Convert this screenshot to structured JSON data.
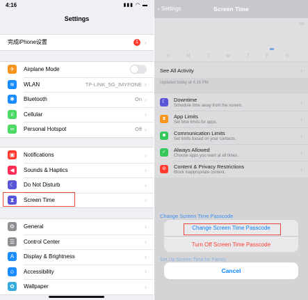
{
  "left": {
    "status_time": "4:16",
    "nav_title": "Settings",
    "setup_row": {
      "label": "完成iPhone设置",
      "badge": "1"
    },
    "group_connectivity": [
      {
        "label": "Airplane Mode",
        "value": "",
        "icon": "airplane-icon",
        "color": "#f7941d",
        "glyph": "✈"
      },
      {
        "label": "WLAN",
        "value": "TP-LINK_5G_IMYFONE",
        "icon": "wifi-icon",
        "color": "#1a8cff",
        "glyph": "≋"
      },
      {
        "label": "Bluetooth",
        "value": "On",
        "icon": "bluetooth-icon",
        "color": "#1a8cff",
        "glyph": "✱"
      },
      {
        "label": "Cellular",
        "value": "",
        "icon": "cellular-icon",
        "color": "#4cd964",
        "glyph": "ıl"
      },
      {
        "label": "Personal Hotspot",
        "value": "Off",
        "icon": "hotspot-icon",
        "color": "#4cd964",
        "glyph": "∞"
      }
    ],
    "group_notifications": [
      {
        "label": "Notifications",
        "value": "",
        "icon": "notifications-icon",
        "color": "#ff3b30",
        "glyph": "▣"
      },
      {
        "label": "Sounds & Haptics",
        "value": "",
        "icon": "sounds-icon",
        "color": "#ff2d55",
        "glyph": "◀"
      },
      {
        "label": "Do Not Disturb",
        "value": "",
        "icon": "moon-icon",
        "color": "#5856d6",
        "glyph": "☾"
      },
      {
        "label": "Screen Time",
        "value": "",
        "icon": "hourglass-icon",
        "color": "#5856d6",
        "glyph": "⧗"
      }
    ],
    "group_general": [
      {
        "label": "General",
        "value": "",
        "icon": "gear-icon",
        "color": "#8e8e93",
        "glyph": "⚙"
      },
      {
        "label": "Control Center",
        "value": "",
        "icon": "control-center-icon",
        "color": "#8e8e93",
        "glyph": "☰"
      },
      {
        "label": "Display & Brightness",
        "value": "",
        "icon": "display-icon",
        "color": "#1a8cff",
        "glyph": "A"
      },
      {
        "label": "Accessibility",
        "value": "",
        "icon": "accessibility-icon",
        "color": "#1a8cff",
        "glyph": "☺"
      },
      {
        "label": "Wallpaper",
        "value": "",
        "icon": "wallpaper-icon",
        "color": "#35aadc",
        "glyph": "✿"
      }
    ]
  },
  "right": {
    "back_label": "Settings",
    "nav_title": "Screen Time",
    "chart_days": [
      "S",
      "M",
      "T",
      "W",
      "T",
      "F",
      "S"
    ],
    "chart_tick": "0h",
    "see_all": "See All Activity",
    "updated": "Updated today at 4:16 PM",
    "options": [
      {
        "title": "Downtime",
        "sub": "Schedule time away from the screen.",
        "icon": "downtime-icon",
        "color": "#5856d6",
        "glyph": "☾"
      },
      {
        "title": "App Limits",
        "sub": "Set time limits for apps.",
        "icon": "hourglass-icon",
        "color": "#f7941d",
        "glyph": "⧗"
      },
      {
        "title": "Communication Limits",
        "sub": "Set limits based on your contacts.",
        "icon": "contacts-icon",
        "color": "#34c759",
        "glyph": "☻"
      },
      {
        "title": "Always Allowed",
        "sub": "Choose apps you want at all times.",
        "icon": "checkmark-icon",
        "color": "#34c759",
        "glyph": "✓"
      },
      {
        "title": "Content & Privacy Restrictions",
        "sub": "Block inappropriate content.",
        "icon": "restriction-icon",
        "color": "#ff3b30",
        "glyph": "⊘"
      }
    ],
    "change_passcode_link": "Change Screen Time Passcode",
    "sheet": {
      "change": "Change Screen Time Passcode",
      "turn_off": "Turn Off Screen Time Passcode",
      "cancel": "Cancel"
    },
    "family_link": "Set Up Screen Time for Family",
    "colors": {
      "link": "#0a84ff",
      "destructive": "#ff3b30"
    }
  }
}
